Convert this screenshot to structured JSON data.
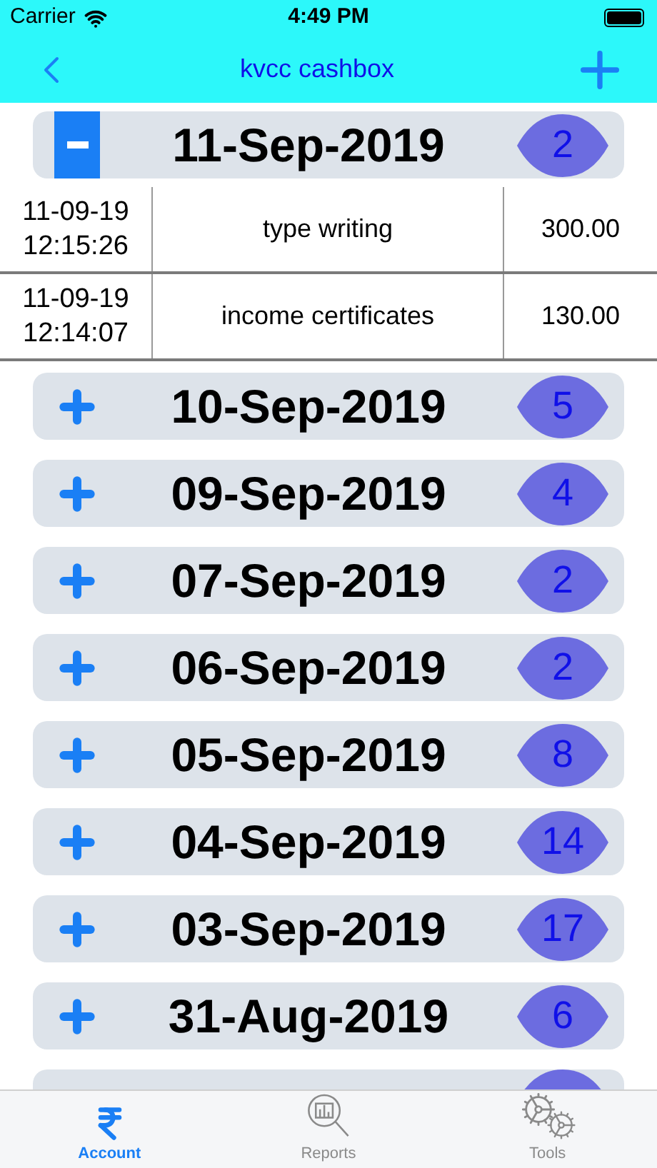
{
  "status_bar": {
    "carrier": "Carrier",
    "time": "4:49 PM"
  },
  "nav": {
    "title": "kvcc cashbox"
  },
  "sections": [
    {
      "date": "11-Sep-2019",
      "count": "2",
      "expanded": true,
      "entries": [
        {
          "date": "11-09-19",
          "time": "12:15:26",
          "description": "type writing",
          "amount": "300.00"
        },
        {
          "date": "11-09-19",
          "time": "12:14:07",
          "description": "income certificates",
          "amount": "130.00"
        }
      ]
    },
    {
      "date": "10-Sep-2019",
      "count": "5",
      "expanded": false
    },
    {
      "date": "09-Sep-2019",
      "count": "4",
      "expanded": false
    },
    {
      "date": "07-Sep-2019",
      "count": "2",
      "expanded": false
    },
    {
      "date": "06-Sep-2019",
      "count": "2",
      "expanded": false
    },
    {
      "date": "05-Sep-2019",
      "count": "8",
      "expanded": false
    },
    {
      "date": "04-Sep-2019",
      "count": "14",
      "expanded": false
    },
    {
      "date": "03-Sep-2019",
      "count": "17",
      "expanded": false
    },
    {
      "date": "31-Aug-2019",
      "count": "6",
      "expanded": false
    }
  ],
  "tabs": [
    {
      "label": "Account",
      "kind": "rupee",
      "selected": true
    },
    {
      "label": "Reports",
      "kind": "reports",
      "selected": false
    },
    {
      "label": "Tools",
      "kind": "tools",
      "selected": false
    }
  ]
}
